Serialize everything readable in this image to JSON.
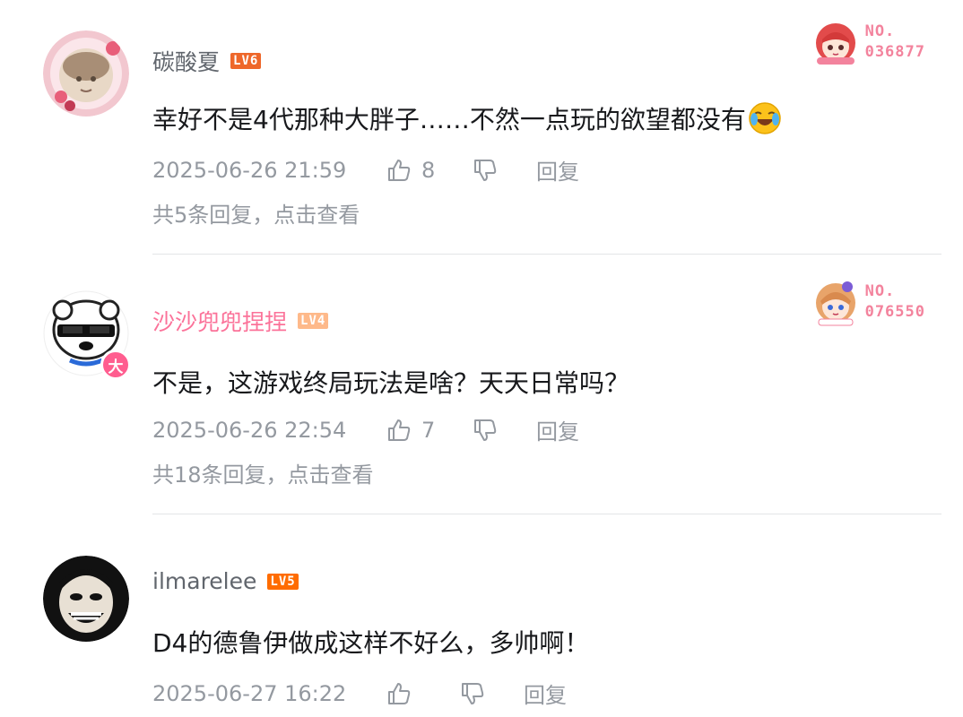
{
  "comments": [
    {
      "username": "碳酸夏",
      "level": "LV6",
      "level_color": "#ee672a",
      "content": "幸好不是4代那种大胖子……不然一点玩的欲望都没有",
      "emoji": "laugh-cry-emoji",
      "time": "2025-06-26 21:59",
      "likes": "8",
      "reply_label": "回复",
      "view_replies": "共5条回复，点击查看",
      "fan_badge": {
        "line1": "NO.",
        "line2": "036877",
        "color": "#f3839d"
      }
    },
    {
      "username": "沙沙兜兜捏捏",
      "username_color": "#fb7299",
      "level": "LV4",
      "level_color": "#feb98a",
      "avatar_badge": "大",
      "content": "不是，这游戏终局玩法是啥？天天日常吗？",
      "time": "2025-06-26 22:54",
      "likes": "7",
      "reply_label": "回复",
      "view_replies": "共18条回复，点击查看",
      "fan_badge": {
        "line1": "NO.",
        "line2": "076550",
        "color": "#f3839d"
      }
    },
    {
      "username": "ilmarelee",
      "level": "LV5",
      "level_color": "#ff6c00",
      "content": "D4的德鲁伊做成这样不好么，多帅啊！",
      "time": "2025-06-27 16:22",
      "likes": "",
      "reply_label": "回复"
    }
  ]
}
